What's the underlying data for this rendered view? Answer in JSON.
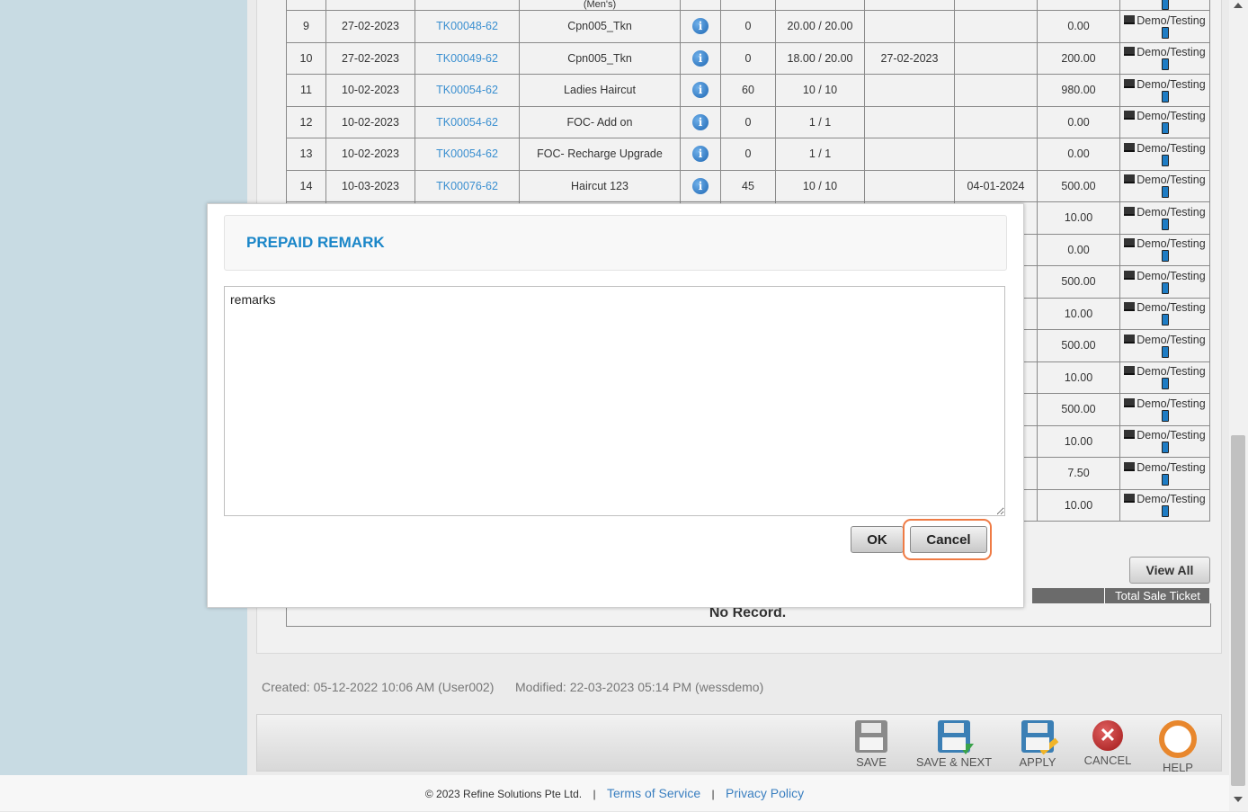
{
  "table": {
    "rows": [
      {
        "no": "",
        "date": "",
        "ticket": "",
        "service": "(Men's)",
        "qty": "",
        "used": "",
        "date2": "",
        "expiry": "",
        "amount": "",
        "device": "",
        "phone": true
      },
      {
        "no": "9",
        "date": "27-02-2023",
        "ticket": "TK00048-62",
        "service": "Cpn005_Tkn",
        "qty": "0",
        "used": "20.00 / 20.00",
        "date2": "",
        "expiry": "",
        "amount": "0.00",
        "device": "Demo/Testing"
      },
      {
        "no": "10",
        "date": "27-02-2023",
        "ticket": "TK00049-62",
        "service": "Cpn005_Tkn",
        "qty": "0",
        "used": "18.00 / 20.00",
        "date2": "27-02-2023",
        "expiry": "",
        "amount": "200.00",
        "device": "Demo/Testing"
      },
      {
        "no": "11",
        "date": "10-02-2023",
        "ticket": "TK00054-62",
        "service": "Ladies Haircut",
        "qty": "60",
        "used": "10 / 10",
        "date2": "",
        "expiry": "",
        "amount": "980.00",
        "device": "Demo/Testing"
      },
      {
        "no": "12",
        "date": "10-02-2023",
        "ticket": "TK00054-62",
        "service": "FOC- Add on",
        "qty": "0",
        "used": "1 / 1",
        "date2": "",
        "expiry": "",
        "amount": "0.00",
        "device": "Demo/Testing"
      },
      {
        "no": "13",
        "date": "10-02-2023",
        "ticket": "TK00054-62",
        "service": "FOC- Recharge Upgrade",
        "qty": "0",
        "used": "1 / 1",
        "date2": "",
        "expiry": "",
        "amount": "0.00",
        "device": "Demo/Testing"
      },
      {
        "no": "14",
        "date": "10-03-2023",
        "ticket": "TK00076-62",
        "service": "Haircut 123",
        "qty": "45",
        "used": "10 / 10",
        "date2": "",
        "expiry": "04-01-2024",
        "amount": "500.00",
        "device": "Demo/Testing"
      },
      {
        "no": "",
        "date": "",
        "ticket": "",
        "service": "",
        "qty": "",
        "used": "",
        "date2": "",
        "expiry": "",
        "amount": "10.00",
        "device": "Demo/Testing"
      },
      {
        "no": "",
        "date": "",
        "ticket": "",
        "service": "",
        "qty": "",
        "used": "",
        "date2": "",
        "expiry": "",
        "amount": "0.00",
        "device": "Demo/Testing"
      },
      {
        "no": "",
        "date": "",
        "ticket": "",
        "service": "",
        "qty": "",
        "used": "",
        "date2": "",
        "expiry": "",
        "amount": "500.00",
        "device": "Demo/Testing"
      },
      {
        "no": "",
        "date": "",
        "ticket": "",
        "service": "",
        "qty": "",
        "used": "",
        "date2": "",
        "expiry": "",
        "amount": "10.00",
        "device": "Demo/Testing"
      },
      {
        "no": "",
        "date": "",
        "ticket": "",
        "service": "",
        "qty": "",
        "used": "",
        "date2": "",
        "expiry": "",
        "amount": "500.00",
        "device": "Demo/Testing"
      },
      {
        "no": "",
        "date": "",
        "ticket": "",
        "service": "",
        "qty": "",
        "used": "",
        "date2": "",
        "expiry": "",
        "amount": "10.00",
        "device": "Demo/Testing"
      },
      {
        "no": "",
        "date": "",
        "ticket": "",
        "service": "",
        "qty": "",
        "used": "",
        "date2": "",
        "expiry": "",
        "amount": "500.00",
        "device": "Demo/Testing"
      },
      {
        "no": "",
        "date": "",
        "ticket": "",
        "service": "",
        "qty": "",
        "used": "",
        "date2": "",
        "expiry": "",
        "amount": "10.00",
        "device": "Demo/Testing"
      },
      {
        "no": "",
        "date": "",
        "ticket": "",
        "service": "",
        "qty": "",
        "used": "",
        "date2": "",
        "expiry": "",
        "amount": "7.50",
        "device": "Demo/Testing"
      },
      {
        "no": "",
        "date": "",
        "ticket": "",
        "service": "",
        "qty": "",
        "used": "",
        "date2": "",
        "expiry": "",
        "amount": "10.00",
        "device": "Demo/Testing"
      }
    ]
  },
  "sale_ticket": {
    "view_all_label": "View All",
    "header": "Total Sale Ticket",
    "no_record": "No Record."
  },
  "audit": {
    "created": "Created: 05-12-2022 10:06 AM (User002)",
    "modified": "Modified: 22-03-2023 05:14 PM (wessdemo)"
  },
  "toolbar": {
    "save": "SAVE",
    "save_next": "SAVE & NEXT",
    "apply": "APPLY",
    "cancel": "CANCEL",
    "help": "HELP"
  },
  "footer": {
    "copyright": "© 2023 Refine Solutions Pte Ltd.",
    "terms": "Terms of Service",
    "privacy": "Privacy Policy",
    "separator": "|"
  },
  "modal": {
    "title": "PREPAID REMARK",
    "remarks_value": "remarks",
    "ok_label": "OK",
    "cancel_label": "Cancel"
  },
  "colors": {
    "accent": "#1a86c8",
    "link": "#3a8fd0",
    "highlight": "#ef7b45"
  }
}
